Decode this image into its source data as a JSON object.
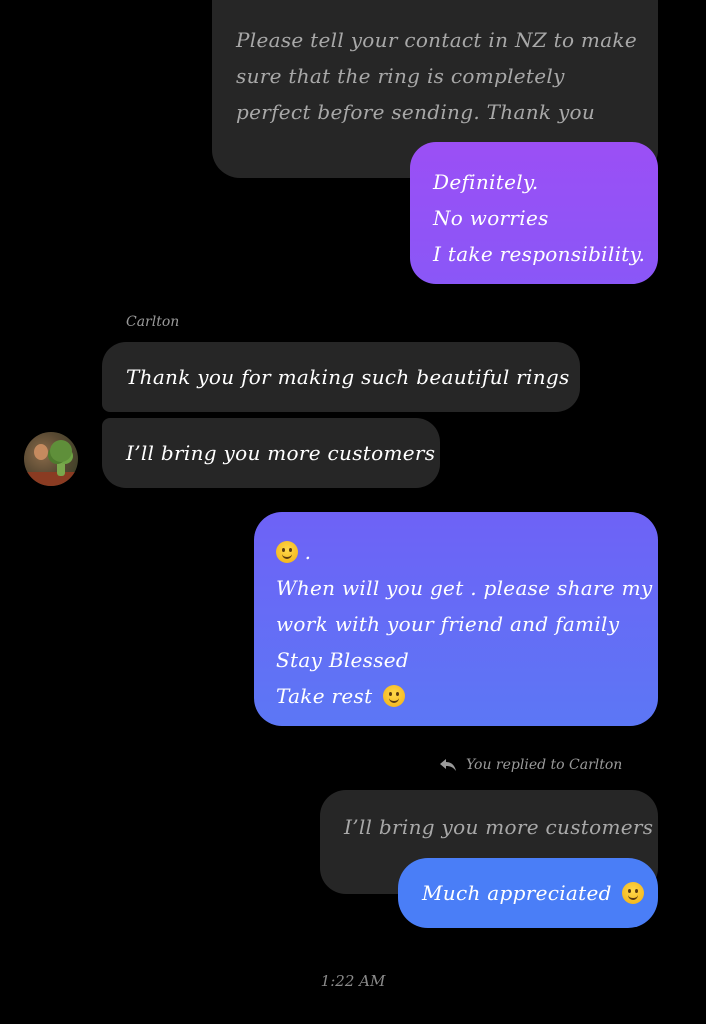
{
  "messages": {
    "quoted_top": {
      "lines": [
        "Please tell your contact in NZ to make",
        "sure that the ring is completely",
        "perfect before sending. Thank you"
      ]
    },
    "sent_1": {
      "lines": [
        "Definitely.",
        "No worries",
        "I take responsibility."
      ]
    },
    "received": {
      "sender": "Carlton",
      "message_1": "Thank you for making such beautiful rings",
      "message_2": "I’ll bring you more customers"
    },
    "sent_2": {
      "line_1": ".",
      "line_2": "When will you get . please share my",
      "line_3": "work with your friend and family",
      "line_4": "Stay Blessed",
      "line_5": "Take rest"
    },
    "reply": {
      "indicator": "You replied to Carlton",
      "quoted": "I’ll bring you more customers",
      "message": "Much appreciated"
    }
  },
  "timestamp": "1:22 AM",
  "colors": {
    "background": "#000000",
    "received_bubble": "#262626",
    "sent_purple": "#9b4ff5",
    "sent_blue": "#5c77f5",
    "sent_final": "#4a7ef7"
  },
  "icons": {
    "emoji": "slightly-smiling-face",
    "reply": "reply-arrow-icon"
  }
}
